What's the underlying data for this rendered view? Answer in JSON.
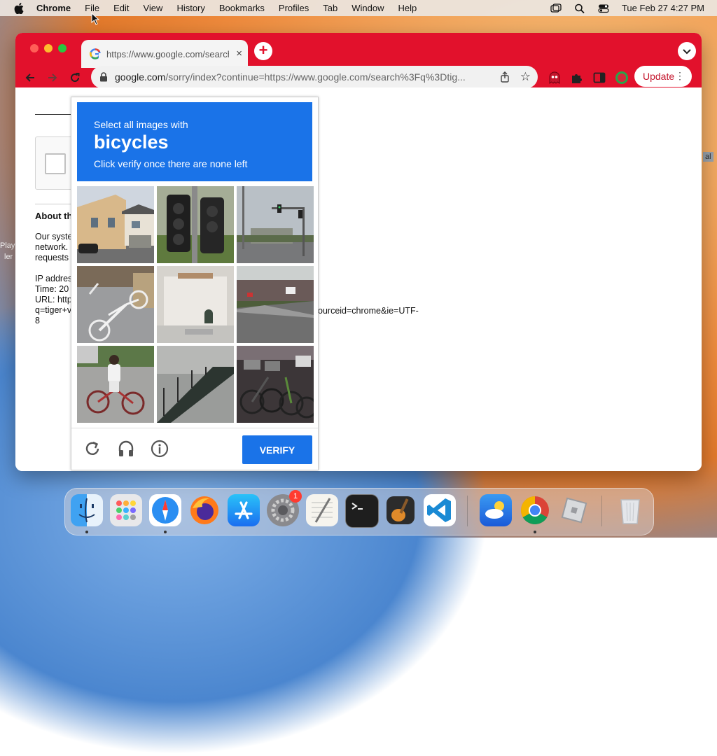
{
  "menubar": {
    "app_name": "Chrome",
    "items": [
      "File",
      "Edit",
      "View",
      "History",
      "Bookmarks",
      "Profiles",
      "Tab",
      "Window",
      "Help"
    ],
    "datetime": "Tue Feb 27  4:27 PM"
  },
  "browser": {
    "tab_title": "https://www.google.com/search?q",
    "tab_close": "×",
    "new_tab": "+",
    "url_host": "google.com",
    "url_rest": "/sorry/index?continue=https://www.google.com/search%3Fq%3Dtig...",
    "update_label": "Update"
  },
  "page": {
    "about_heading": "About th",
    "lines": [
      "Our syste",
      "network.",
      "requests",
      "IP addres",
      "Time: 20",
      "URL: http",
      "q=tiger+v",
      "8"
    ],
    "url_tail": "ourceid=chrome&ie=UTF-"
  },
  "desktop": {
    "left_labels": [
      "Play",
      "ler"
    ],
    "right_label": "al"
  },
  "captcha": {
    "instruction": "Select all images with",
    "target": "bicycles",
    "subtext": "Click verify once there are none left",
    "verify_label": "VERIFY",
    "tiles": [
      "house-with-car",
      "traffic-light-closeup",
      "traffic-lights-intersection",
      "bicycle-on-pavement",
      "white-wall-building",
      "street-with-shops",
      "child-on-bicycle",
      "stair-railing",
      "parked-bicycles"
    ]
  },
  "dock": {
    "apps": [
      "finder",
      "launchpad",
      "safari",
      "firefox",
      "app-store",
      "system-preferences",
      "textedit",
      "terminal",
      "garageband",
      "vscode",
      "weather",
      "chrome",
      "roblox",
      "trash"
    ],
    "system_preferences_badge": "1"
  },
  "colors": {
    "chrome_red": "#e2112c",
    "captcha_blue": "#1a73e8"
  }
}
